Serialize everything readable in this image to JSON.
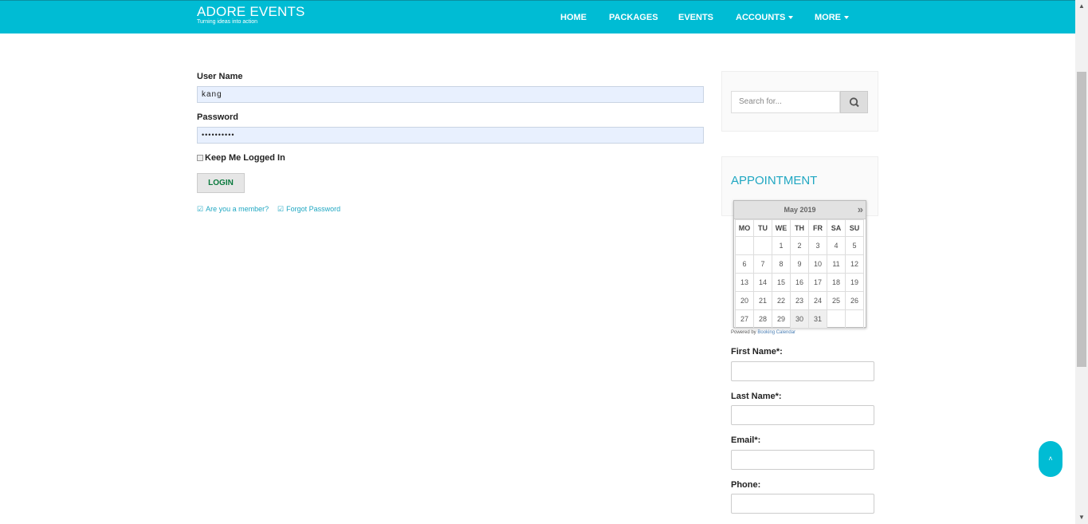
{
  "brand": {
    "name": "ADORE EVENTS",
    "tagline": "Turning ideas into action"
  },
  "nav": {
    "home": "HOME",
    "packages": "PACKAGES",
    "events": "EVENTS",
    "accounts": "ACCOUNTS",
    "more": "MORE"
  },
  "login": {
    "username_label": "User Name",
    "username_value": "kang",
    "password_label": "Password",
    "password_value": "••••••••••",
    "remember_label": "Keep Me Logged In",
    "login_button": "LOGIN",
    "member_link": "Are you a member?",
    "forgot_link": "Forgot Password"
  },
  "sidebar": {
    "search_placeholder": "Search for...",
    "appointment_title": "APPOINTMENT",
    "calendar": {
      "month": "May 2019",
      "next": "»",
      "weekdays": [
        "MO",
        "TU",
        "WE",
        "TH",
        "FR",
        "SA",
        "SU"
      ],
      "weeks": [
        [
          "",
          "",
          "1",
          "2",
          "3",
          "4",
          "5"
        ],
        [
          "6",
          "7",
          "8",
          "9",
          "10",
          "11",
          "12"
        ],
        [
          "13",
          "14",
          "15",
          "16",
          "17",
          "18",
          "19"
        ],
        [
          "20",
          "21",
          "22",
          "23",
          "24",
          "25",
          "26"
        ],
        [
          "27",
          "28",
          "29",
          "30",
          "31",
          "",
          ""
        ]
      ]
    },
    "powered_prefix": "Powered by",
    "powered_link": "Booking Calendar",
    "first_name_label": "First Name*:",
    "last_name_label": "Last Name*:",
    "email_label": "Email*:",
    "phone_label": "Phone:"
  },
  "colors": {
    "accent": "#00bcd4",
    "link": "#20a7c2",
    "login_text": "#0b7a3e"
  },
  "icons": {
    "search": "search-icon",
    "back_to_top": "chevron-up-icon",
    "checkbox": "check-square-icon"
  }
}
